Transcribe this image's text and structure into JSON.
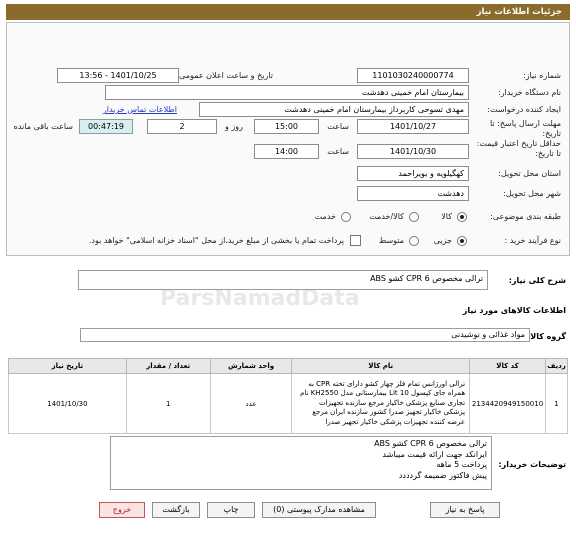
{
  "header": {
    "title": "جزئیات اطلاعات نیاز"
  },
  "fields": {
    "need_number_label": "شماره نیاز:",
    "need_number": "1101030240000774",
    "announce_label": "تاریخ و ساعت اعلان عمومی:",
    "announce_value": "1401/10/25 - 13:56",
    "buyer_org_label": "نام دستگاه خریدار:",
    "buyer_org": "بیمارستان امام خمینی دهدشت",
    "creator_label": "ایجاد کننده درخواست:",
    "creator": "مهدی تسوحی کاربرداز بیمارستان امام خمینی دهدشت",
    "contact_link": "اطلاعات تماس خریدار",
    "deadline_label": "مهلت ارسال پاسخ: تا تاریخ:",
    "deadline_date": "1401/10/27",
    "time_word": "ساعت",
    "deadline_time": "15:00",
    "days_value": "2",
    "days_word": "روز و",
    "remaining_value": "00:47:19",
    "remaining_word": "ساعت باقی مانده",
    "validity_label": "حداقل تاریخ اعتبار قیمت: تا تاریخ:",
    "validity_date": "1401/10/30",
    "validity_time": "14:00",
    "province_label": "استان محل تحویل:",
    "province": "کهگیلویه و بویراحمد",
    "city_label": "شهر محل تحویل:",
    "city": "دهدشت",
    "category_label": "طبقه بندی موضوعی:",
    "category_options": [
      "کالا",
      "کالا/خدمت",
      "خدمت"
    ],
    "purchase_label": "نوع فرآیند خرید :",
    "purchase_options": [
      "جزیی",
      "متوسط"
    ],
    "purchase_note": "پرداخت تمام یا بخشی از مبلغ خرید،از محل \"اسناد خزانه اسلامی\" خواهد بود."
  },
  "summary": {
    "label": "شرح کلی نیاز:",
    "value": "ترالی مخصوص CPR  6 کشو ABS"
  },
  "goods": {
    "section_title": "اطلاعات کالاهای مورد نیاز",
    "group_label": "گروه کالا:",
    "group_value": "مواد غذائی و نوشیدنی",
    "table": {
      "headers": [
        "ردیف",
        "کد کالا",
        "نام کالا",
        "واحد شمارش",
        "تعداد / مقدار",
        "تاریخ نیاز"
      ],
      "rows": [
        {
          "row": "1",
          "code": "2134420949150010",
          "name": "ترالی اورژانس تمام فلز چهار کشو دارای تخته CPR به همراه جای کپسول Lit 10 بیمارستانی مدل KH2550 نام تجاری صنایع پزشکی خاکیار مرجع سازنده تجهیزات پزشکی خاکیار تجهیز صدرا کشور سازنده ایران مرجع عرضه کننده تجهیزات پزشکی خاکیار تجهیز صدرا",
          "unit": "عدد",
          "qty": "1",
          "date": "1401/10/30"
        }
      ]
    }
  },
  "buyer_notes": {
    "label": "توضیحات خریدار:",
    "lines": [
      "ترالی مخصوص CPR  6 کشو ABS",
      "ایرانکد جهت ارائه قیمت میباشد",
      "پرداخت 5 ماهه",
      "پیش فاکتور ضمیمه گردددد"
    ]
  },
  "buttons": {
    "reply": "پاسخ به نیاز",
    "attachments": "مشاهده مدارک پیوستی (0)",
    "print": "چاپ",
    "back": "بازگشت",
    "exit": "خروج"
  }
}
